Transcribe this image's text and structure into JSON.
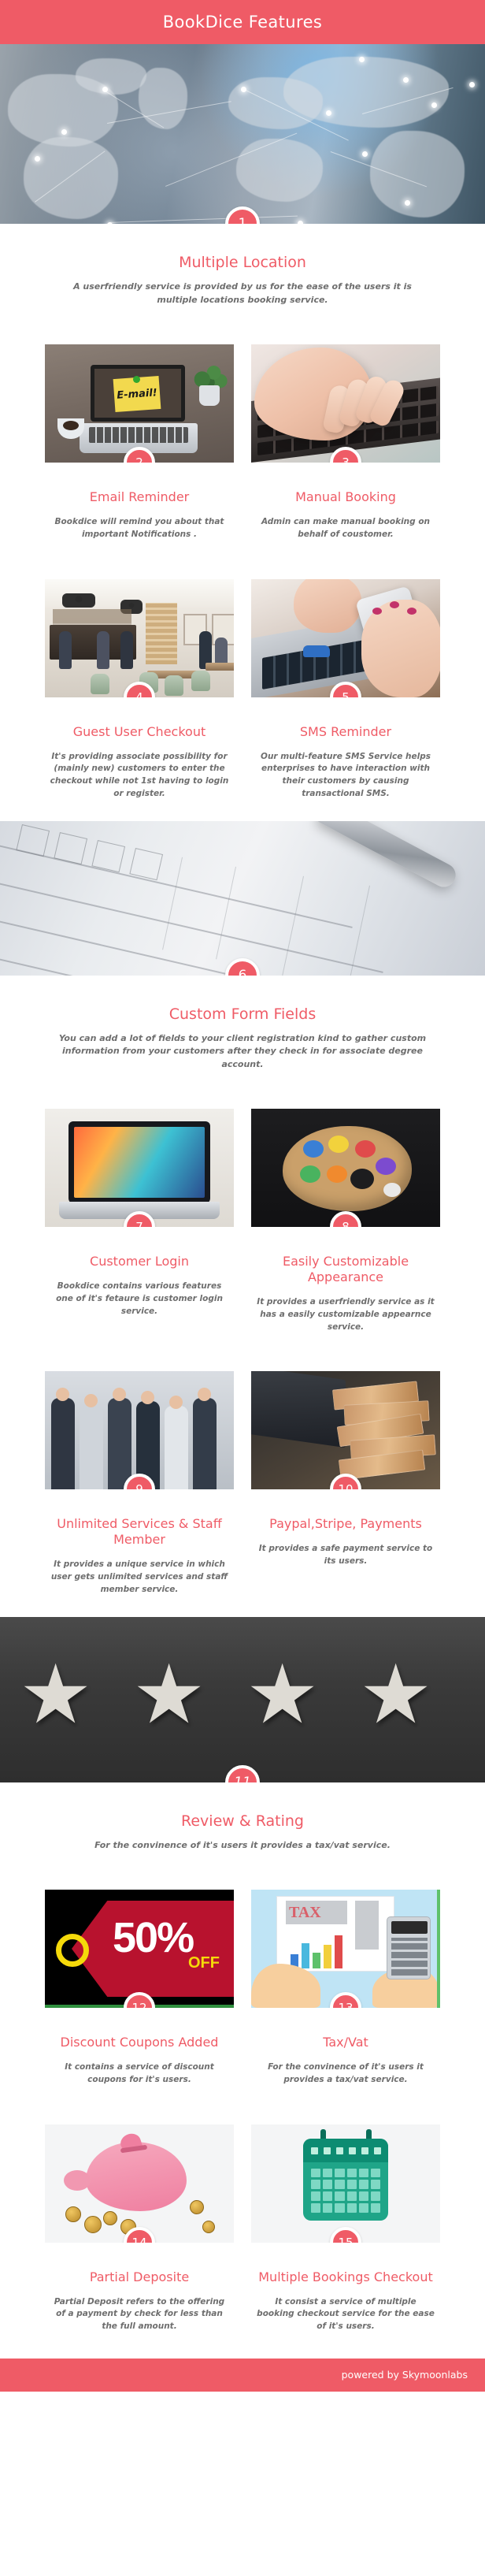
{
  "header": {
    "title": "BookDice Features"
  },
  "footer": {
    "text": "powered by Skymoonlabs"
  },
  "colors": {
    "accent": "#ef5b66",
    "body_text": "#6e6e6e",
    "background": "#ffffff"
  },
  "banners": [
    {
      "id": "banner-world-map",
      "image_alt": "world-map-network",
      "badge": "1",
      "title": "Multiple Location",
      "description": "A userfriendly service is provided by us for the ease of the users it is multiple locations booking service."
    },
    {
      "id": "banner-form-document",
      "image_alt": "form-document-with-pen",
      "badge": "6",
      "title": "Custom Form Fields",
      "description": "You can add a lot of fields to your client registration kind to gather custom information from your customers after they check in for associate degree account."
    },
    {
      "id": "banner-star-rating",
      "image_alt": "four-stars-on-concrete",
      "badge": "11",
      "title": "Review & Rating",
      "description": "For the convinence of it's users it provides a tax/vat service."
    }
  ],
  "feature_rows": [
    {
      "row": 1,
      "cards": [
        {
          "badge": "2",
          "title": "Email Reminder",
          "description": "Bookdice will remind you about that important Notifications .",
          "image_alt": "laptop-with-email-sticky-note",
          "scene": "desk"
        },
        {
          "badge": "3",
          "title": "Manual Booking",
          "description": "Admin can make manual booking on behalf of coustomer.",
          "image_alt": "hand-typing-on-keyboard",
          "scene": "keyboard"
        }
      ]
    },
    {
      "row": 2,
      "cards": [
        {
          "badge": "4",
          "title": "Guest User Checkout",
          "description": "It's providing associate possibility for (mainly new) customers to enter the checkout while not 1st having to login or register.",
          "image_alt": "restaurant-interior",
          "scene": "restaurant"
        },
        {
          "badge": "5",
          "title": "SMS Reminder",
          "description": "Our multi-feature SMS Service helps enterprises to have interaction with their customers by  causing transactional SMS.",
          "image_alt": "hands-holding-phone-over-laptop",
          "scene": "phone"
        }
      ]
    },
    {
      "row": 3,
      "cards": [
        {
          "badge": "7",
          "title": "Customer Login",
          "description": "Bookdice contains various features one of it's fetaure is customer login service.",
          "image_alt": "laptop-with-colorful-screen",
          "scene": "login"
        },
        {
          "badge": "8",
          "title": "Easily Customizable Appearance",
          "description": "It provides a userfriendly service as it has a easily customizable appearnce service.",
          "image_alt": "paint-palette-with-colors",
          "scene": "palette"
        }
      ]
    },
    {
      "row": 4,
      "cards": [
        {
          "badge": "9",
          "title": "Unlimited Services & Staff Member",
          "description": "It provides a unique service in which user gets unlimited services and staff member service.",
          "image_alt": "business-team-group-photo",
          "scene": "team"
        },
        {
          "badge": "10",
          "title": "Paypal,Stripe, Payments",
          "description": "It provides a safe payment service to its users.",
          "image_alt": "money-banknotes-with-laptop",
          "scene": "money"
        }
      ]
    },
    {
      "row": 5,
      "cards": [
        {
          "badge": "12",
          "title": "Discount Coupons Added",
          "description": "It contains a service of discount coupons for it's users.",
          "image_alt": "fifty-percent-off-tag",
          "scene": "coupon",
          "labels": {
            "percent": "50%",
            "off": "OFF"
          }
        },
        {
          "badge": "13",
          "title": "Tax/Vat",
          "description": "For the convinence of it's users it provides a tax/vat service.",
          "image_alt": "tax-chart-with-calculator",
          "scene": "tax",
          "labels": {
            "tax": "TAX"
          }
        }
      ]
    },
    {
      "row": 6,
      "cards": [
        {
          "badge": "14",
          "title": "Partial Deposite",
          "description": "Partial Deposit refers to the offering of a payment by check for less than the full amount.",
          "image_alt": "piggy-bank-with-coins",
          "scene": "piggy"
        },
        {
          "badge": "15",
          "title": "Multiple Bookings Checkout",
          "description": "It consist a service of multiple booking checkout service for the ease of it's users.",
          "image_alt": "calendar-icon",
          "scene": "cal"
        }
      ]
    }
  ]
}
